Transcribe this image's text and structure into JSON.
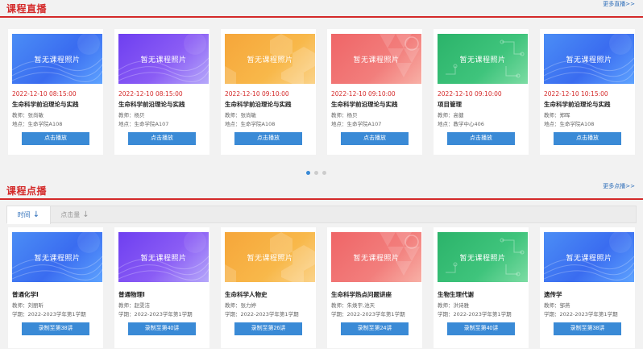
{
  "live_section": {
    "title": "课程直播",
    "more": "更多直播>>",
    "cards": [
      {
        "thumb_text": "暂无课程照片",
        "theme": "blue",
        "time": "2022-12-10 08:15:00",
        "name": "生命科学前沿理论与实践",
        "teacher": "教师：张尚敏",
        "location": "地点：生命学院A108",
        "button": "点击播放"
      },
      {
        "thumb_text": "暂无课程照片",
        "theme": "purple",
        "time": "2022-12-10 08:15:00",
        "name": "生命科学前沿理论与实践",
        "teacher": "教师：杨贝",
        "location": "地点：生命学院A107",
        "button": "点击播放"
      },
      {
        "thumb_text": "暂无课程照片",
        "theme": "orange",
        "time": "2022-12-10 09:10:00",
        "name": "生命科学前沿理论与实践",
        "teacher": "教师：张尚敏",
        "location": "地点：生命学院A108",
        "button": "点击播放"
      },
      {
        "thumb_text": "暂无课程照片",
        "theme": "red",
        "time": "2022-12-10 09:10:00",
        "name": "生命科学前沿理论与实践",
        "teacher": "教师：杨贝",
        "location": "地点：生命学院A107",
        "button": "点击播放"
      },
      {
        "thumb_text": "暂无课程照片",
        "theme": "green",
        "time": "2022-12-10 09:10:00",
        "name": "项目管理",
        "teacher": "教师：高健",
        "location": "地点：教学中心406",
        "button": "点击播放"
      },
      {
        "thumb_text": "暂无课程照片",
        "theme": "blue",
        "time": "2022-12-10 10:15:00",
        "name": "生命科学前沿理论与实践",
        "teacher": "教师：郑晖",
        "location": "地点：生命学院A108",
        "button": "点击播放"
      }
    ],
    "pager_count": 3,
    "pager_active": 0
  },
  "vod_section": {
    "title": "课程点播",
    "more": "更多点播>>",
    "sort_tabs": [
      {
        "label": "时间",
        "arrow": "↓",
        "active": true
      },
      {
        "label": "点击量",
        "arrow": "↓",
        "active": false
      }
    ],
    "cards": [
      {
        "thumb_text": "暂无课程照片",
        "theme": "blue",
        "name": "普通化学I",
        "teacher": "教师：刘丽昕",
        "term": "学期：2022-2023学年第1学期",
        "button": "录制至第38讲"
      },
      {
        "thumb_text": "暂无课程照片",
        "theme": "purple",
        "name": "普通物理I",
        "teacher": "教师：赵雯洁",
        "term": "学期：2022-2023学年第1学期",
        "button": "录制至第40讲"
      },
      {
        "thumb_text": "暂无课程照片",
        "theme": "orange",
        "name": "生命科学人物史",
        "teacher": "教师：张力婷",
        "term": "学期：2022-2023学年第1学期",
        "button": "录制至第26讲"
      },
      {
        "thumb_text": "暂无课程照片",
        "theme": "red",
        "name": "生命科学热点问题讲座",
        "teacher": "教师：朱焕宇,池天",
        "term": "学期：2022-2023学年第1学期",
        "button": "录制至第24讲"
      },
      {
        "thumb_text": "暂无课程照片",
        "theme": "green",
        "name": "生物生理代谢",
        "teacher": "教师：洪诗雅",
        "term": "学期：2022-2023学年第1学期",
        "button": "录制至第40讲"
      },
      {
        "thumb_text": "暂无课程照片",
        "theme": "blue",
        "name": "遗传学",
        "teacher": "教师：邹燕",
        "term": "学期：2022-2023学年第1学期",
        "button": "录制至第38讲"
      }
    ]
  }
}
